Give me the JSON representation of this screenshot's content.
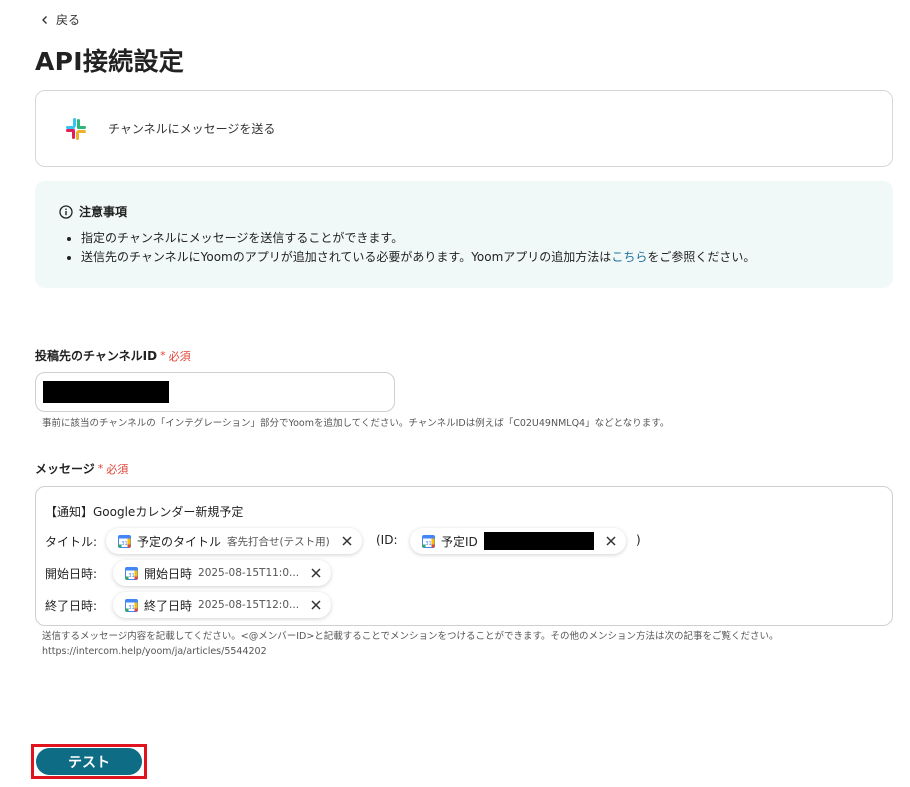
{
  "nav": {
    "back_label": "戻る"
  },
  "page": {
    "title": "API接続設定"
  },
  "action": {
    "label": "チャンネルにメッセージを送る"
  },
  "notice": {
    "heading": "注意事項",
    "item1": "指定のチャンネルにメッセージを送信することができます。",
    "item2_prefix": "送信先のチャンネルにYoomのアプリが追加されている必要があります。Yoomアプリの追加方法は",
    "item2_link": "こちら",
    "item2_suffix": "をご参照ください。"
  },
  "channel_field": {
    "label": "投稿先のチャンネルID",
    "required_label": "必須",
    "required_mark": "*",
    "hint": "事前に該当のチャンネルの「インテグレーション」部分でYoomを追加してください。チャンネルIDは例えば「C02U49NMLQ4」などとなります。"
  },
  "message_field": {
    "label": "メッセージ",
    "required_label": "必須",
    "required_mark": "*",
    "line1": "【通知】Googleカレンダー新規予定",
    "title_label": "タイトル:",
    "title_pill": {
      "name": "予定のタイトル",
      "value": "客先打合せ(テスト用)"
    },
    "id_prefix": "(ID:",
    "id_pill": {
      "name": "予定ID"
    },
    "id_suffix": ")",
    "start_label": "開始日時:",
    "start_pill": {
      "name": "開始日時",
      "value": "2025-08-15T11:0..."
    },
    "end_label": "終了日時:",
    "end_pill": {
      "name": "終了日時",
      "value": "2025-08-15T12:0..."
    },
    "hint_line1": "送信するメッセージ内容を記載してください。<@メンバーID>と記載することでメンションをつけることができます。その他のメンション方法は次の記事をご覧ください。",
    "hint_line2": "https://intercom.help/yoom/ja/articles/5544202"
  },
  "actions": {
    "test_label": "テスト"
  },
  "icons": {
    "back": "chevron-left-icon",
    "app": "slack-icon",
    "info": "info-icon",
    "calendar": "google-calendar-icon",
    "remove": "close-icon"
  },
  "colors": {
    "primary": "#0f6c85",
    "required": "#e0463a",
    "notice_bg": "#f1f9f8",
    "link": "#1a6f9a",
    "highlight": "#e0141e"
  }
}
